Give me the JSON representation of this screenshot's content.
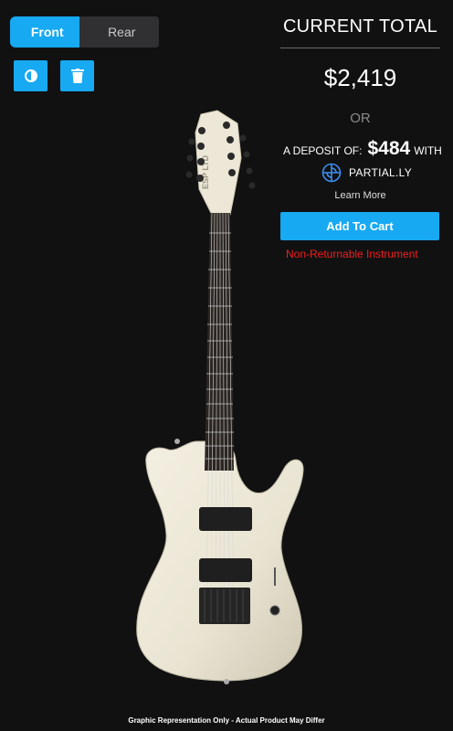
{
  "view_toggle": {
    "front_label": "Front",
    "rear_label": "Rear",
    "selected": "Front"
  },
  "toolbar": {
    "contrast_icon": "contrast-icon",
    "trash_icon": "trash-icon",
    "accent": "#17a9f2"
  },
  "summary": {
    "title": "CURRENT TOTAL",
    "price": "$2,419",
    "or_text": "OR",
    "deposit_prefix": "A DEPOSIT OF:",
    "deposit_amount": "$484",
    "deposit_suffix": "WITH",
    "provider": "PARTIAL.LY",
    "learn_more": "Learn More",
    "add_to_cart": "Add To Cart",
    "non_returnable": "Non-Returnable Instrument",
    "warning_color": "#f21e1e"
  },
  "guitar": {
    "headstock_logo": "ESP LTD",
    "body_color": "#ece7d6"
  },
  "footer": {
    "disclaimer": "Graphic Representation Only - Actual Product May Differ"
  }
}
